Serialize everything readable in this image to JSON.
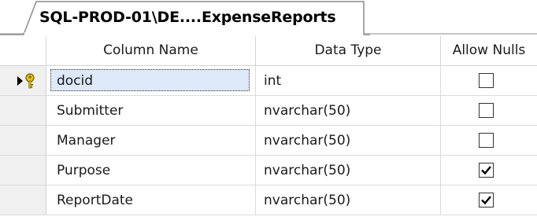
{
  "tab": {
    "title": "SQL-PROD-01\\DE....ExpenseReports"
  },
  "grid": {
    "headers": {
      "column_name": "Column Name",
      "data_type": "Data Type",
      "allow_nulls": "Allow Nulls"
    },
    "rows": [
      {
        "name": "docid",
        "type": "int",
        "allow_nulls": false,
        "primary_key": true,
        "current": true
      },
      {
        "name": "Submitter",
        "type": "nvarchar(50)",
        "allow_nulls": false
      },
      {
        "name": "Manager",
        "type": "nvarchar(50)",
        "allow_nulls": false
      },
      {
        "name": "Purpose",
        "type": "nvarchar(50)",
        "allow_nulls": true
      },
      {
        "name": "ReportDate",
        "type": "nvarchar(50)",
        "allow_nulls": true
      }
    ]
  },
  "icons": {
    "row_indicator": "current-row-arrow-icon",
    "primary_key": "primary-key-icon",
    "checkmark": "checkmark-icon"
  },
  "colors": {
    "focus_fill": "#dde8f8",
    "selector_bg": "#f0f0f0",
    "key_gold": "#e8c200"
  }
}
